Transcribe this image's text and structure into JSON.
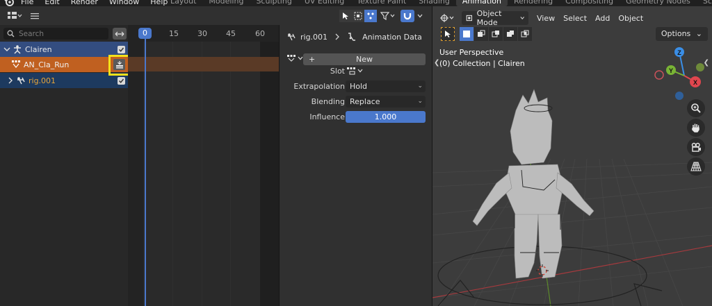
{
  "topbar": {
    "menus": [
      "File",
      "Edit",
      "Render",
      "Window",
      "Help"
    ],
    "tabs": [
      "Layout",
      "Modeling",
      "Sculpting",
      "UV Editing",
      "Texture Paint",
      "Shading",
      "Animation",
      "Rendering",
      "Compositing",
      "Geometry Nodes",
      "Scripting"
    ],
    "active_tab": "Animation",
    "add_tab": "+"
  },
  "outliner": {
    "search_placeholder": "Search",
    "items": [
      {
        "label": "Clairen",
        "type": "collection",
        "checked": true
      },
      {
        "label": "AN_Cla_Run",
        "type": "action"
      },
      {
        "label": "rig.001",
        "type": "armature",
        "checked": true
      }
    ]
  },
  "timeline": {
    "current_frame": "0",
    "frame_ticks": [
      "15",
      "30",
      "45",
      "60"
    ]
  },
  "props": {
    "breadcrumb_object": "rig.001",
    "breadcrumb_section": "Animation Data",
    "new_label": "New",
    "fields": [
      {
        "label": "Slot",
        "value": ""
      },
      {
        "label": "Extrapolation",
        "value": "Hold"
      },
      {
        "label": "Blending",
        "value": "Replace"
      },
      {
        "label": "Influence",
        "value": "1.000"
      }
    ]
  },
  "viewport": {
    "mode": "Object Mode",
    "menus": [
      "View",
      "Select",
      "Add",
      "Object"
    ],
    "options_label": "Options",
    "perspective_label": "User Perspective",
    "collection_label": "(0) Collection | Clairen",
    "gizmo_axes": {
      "x": "X",
      "y": "Y",
      "z": "Z"
    },
    "colors": {
      "x": "#e0464e",
      "y": "#79b435",
      "z": "#3a8ee6"
    }
  },
  "colors": {
    "accent_blue": "#4a78cc",
    "action_orange": "#c06020",
    "highlight_yellow": "#f4e11a"
  }
}
